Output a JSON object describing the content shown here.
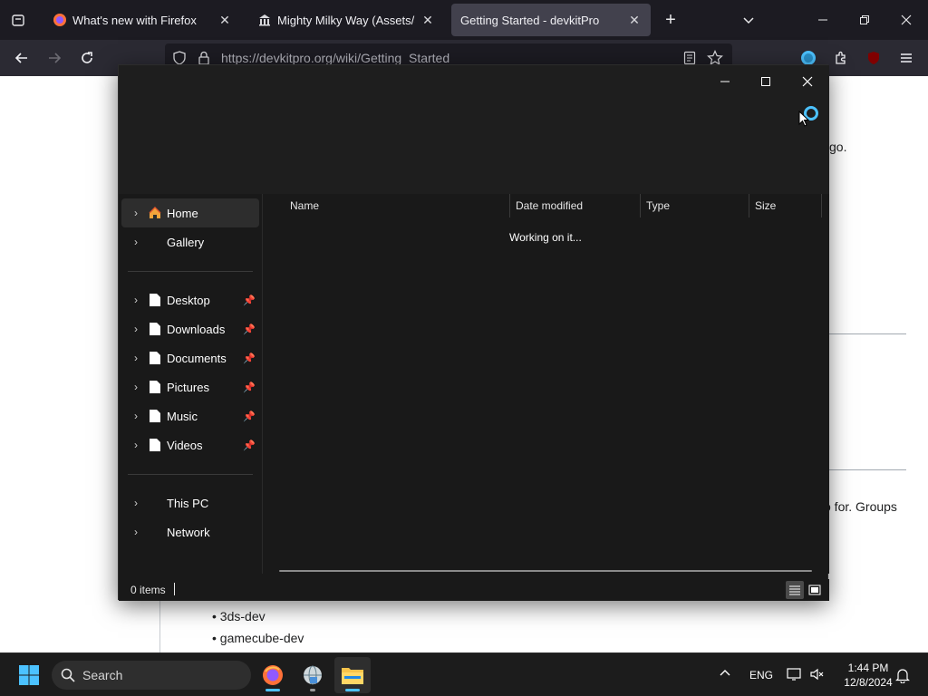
{
  "browser": {
    "tabs": [
      {
        "title": "What's new with Firefox",
        "icon": "firefox-icon",
        "active": false
      },
      {
        "title": "Mighty Milky Way (Assets/Sour",
        "icon": "bank-icon",
        "active": false
      },
      {
        "title": "Getting Started - devkitPro",
        "icon": "",
        "active": true
      }
    ],
    "new_tab": "+",
    "url": "https://devkitpro.org/wiki/Getting_Started"
  },
  "page": {
    "fragment_ago": "go.",
    "fragment_groups": "o for. Groups",
    "list_items": [
      "3ds-dev",
      "gamecube-dev"
    ]
  },
  "explorer": {
    "nav": {
      "items": [
        {
          "label": "Home",
          "icon": "home-icon",
          "pinned": false,
          "selected": true
        },
        {
          "label": "Gallery",
          "icon": "",
          "pinned": false,
          "selected": false
        },
        {
          "label": "Desktop",
          "icon": "file-icon",
          "pinned": true,
          "selected": false
        },
        {
          "label": "Downloads",
          "icon": "file-icon",
          "pinned": true,
          "selected": false
        },
        {
          "label": "Documents",
          "icon": "file-icon",
          "pinned": true,
          "selected": false
        },
        {
          "label": "Pictures",
          "icon": "file-icon",
          "pinned": true,
          "selected": false
        },
        {
          "label": "Music",
          "icon": "file-icon",
          "pinned": true,
          "selected": false
        },
        {
          "label": "Videos",
          "icon": "file-icon",
          "pinned": true,
          "selected": false
        },
        {
          "label": "This PC",
          "icon": "",
          "pinned": false,
          "selected": false
        },
        {
          "label": "Network",
          "icon": "",
          "pinned": false,
          "selected": false
        }
      ]
    },
    "columns": [
      "Name",
      "Date modified",
      "Type",
      "Size"
    ],
    "status_text": "Working on it...",
    "items_count": "0 items"
  },
  "taskbar": {
    "search_label": "Search",
    "language": "ENG",
    "time": "1:44 PM",
    "date": "12/8/2024"
  },
  "colors": {
    "accent": "#4cc2ff",
    "explorer_bg": "#191919",
    "firefox_tabbar": "#1c1b22"
  }
}
